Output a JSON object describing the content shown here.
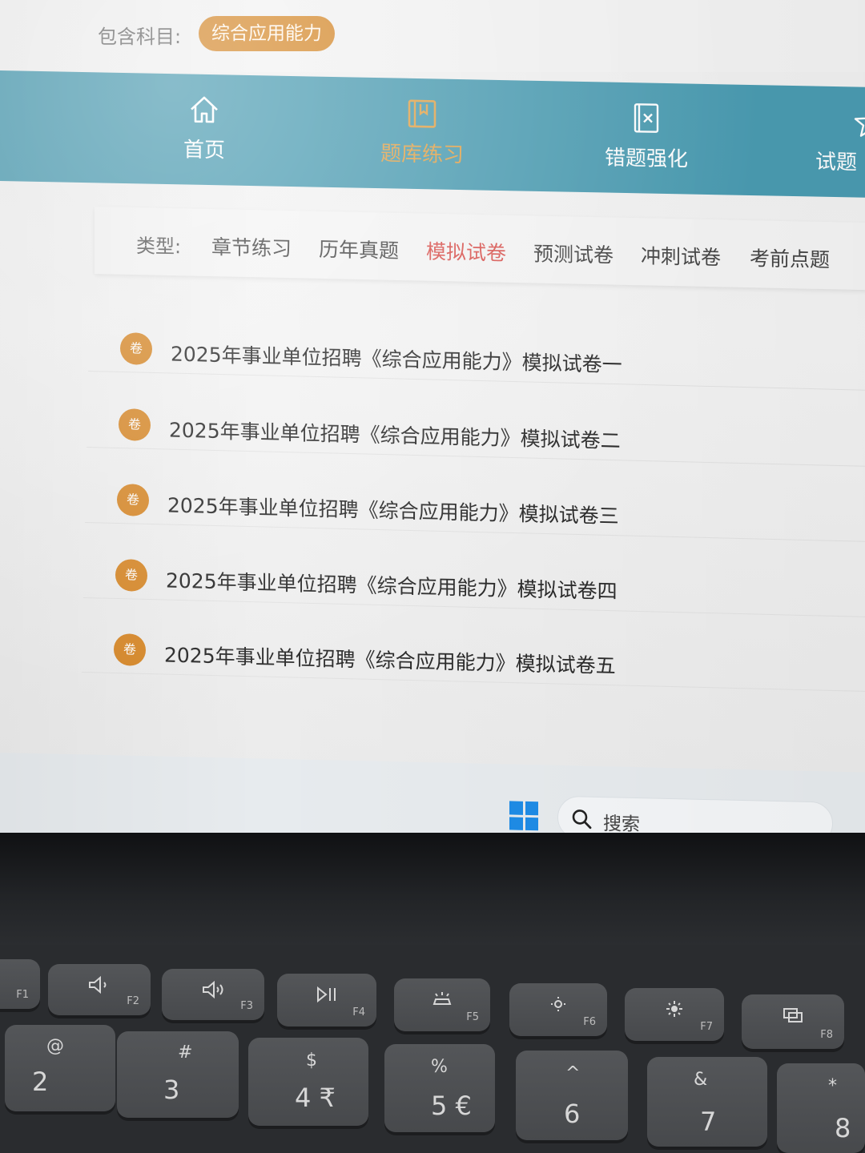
{
  "subject": {
    "label": "包含科目:",
    "selected": "综合应用能力"
  },
  "nav": {
    "items": [
      {
        "label": "首页",
        "icon": "home-icon"
      },
      {
        "label": "题库练习",
        "icon": "book-icon",
        "active": true
      },
      {
        "label": "错题强化",
        "icon": "wrong-question-icon"
      },
      {
        "label": "试题",
        "icon": "star-icon"
      }
    ]
  },
  "types": {
    "label": "类型:",
    "tabs": [
      "章节练习",
      "历年真题",
      "模拟试卷",
      "预测试卷",
      "冲刺试卷",
      "考前点题"
    ],
    "active": "模拟试卷"
  },
  "papers": {
    "badge": "卷",
    "items": [
      "2025年事业单位招聘《综合应用能力》模拟试卷一",
      "2025年事业单位招聘《综合应用能力》模拟试卷二",
      "2025年事业单位招聘《综合应用能力》模拟试卷三",
      "2025年事业单位招聘《综合应用能力》模拟试卷四",
      "2025年事业单位招聘《综合应用能力》模拟试卷五"
    ]
  },
  "taskbar": {
    "search_text": "搜索"
  },
  "keyboard": {
    "fn_keys": [
      "F1",
      "F2",
      "F3",
      "F4",
      "F5",
      "F6",
      "F7",
      "F8"
    ],
    "number_keys": [
      {
        "sym": "@",
        "main": "2"
      },
      {
        "sym": "#",
        "main": "3"
      },
      {
        "sym": "$",
        "main": "4 ₹"
      },
      {
        "sym": "%",
        "main": "5 €"
      },
      {
        "sym": "^",
        "main": "6"
      },
      {
        "sym": "&",
        "main": "7"
      },
      {
        "sym": "*",
        "main": "8"
      }
    ]
  },
  "colors": {
    "nav_bg": "#4a9bb1",
    "accent_orange": "#d88a2c",
    "active_red": "#d9534f"
  }
}
